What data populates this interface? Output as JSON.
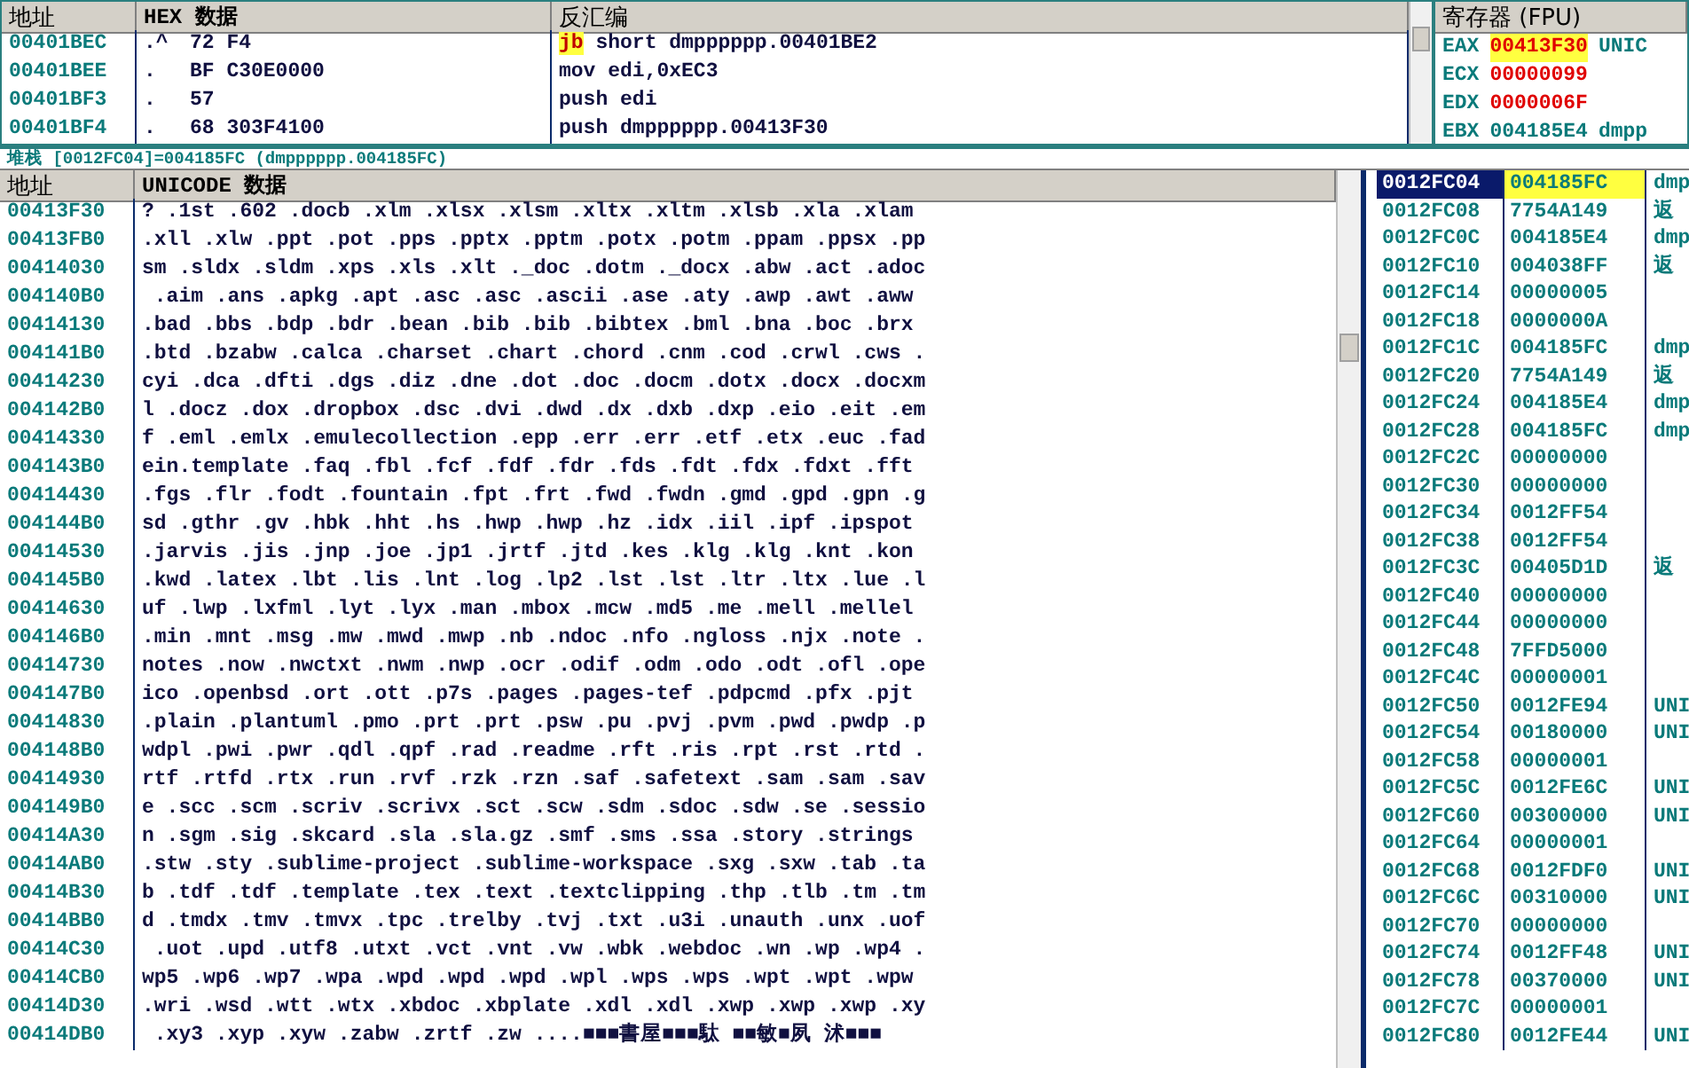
{
  "disassembly": {
    "columns": [
      "地址",
      "HEX 数据",
      "反汇编"
    ],
    "rows": [
      {
        "address": "00401BEC",
        "marker": ".^",
        "hex": "72 F4",
        "mnemonic": "jb",
        "operands": "short dmpppppp.00401BE2",
        "highlight": true
      },
      {
        "address": "00401BEE",
        "marker": ".",
        "hex": "BF C30E0000",
        "mnemonic": "mov",
        "operands": "edi,0xEC3",
        "highlight": false
      },
      {
        "address": "00401BF3",
        "marker": ".",
        "hex": "57",
        "mnemonic": "push",
        "operands": "edi",
        "highlight": false
      },
      {
        "address": "00401BF4",
        "marker": ".",
        "hex": "68 303F4100",
        "mnemonic": "push",
        "operands": "dmpppppp.00413F30",
        "highlight": false
      }
    ]
  },
  "registers": {
    "title": "寄存器 (FPU)",
    "rows": [
      {
        "name": "EAX",
        "value": "00413F30",
        "comment": "UNIC",
        "changed": true,
        "selected": true
      },
      {
        "name": "ECX",
        "value": "00000099",
        "changed": true,
        "selected": false
      },
      {
        "name": "EDX",
        "value": "0000006F",
        "changed": true,
        "selected": false
      },
      {
        "name": "EBX",
        "value": "004185E4",
        "comment": "dmpp",
        "changed": false,
        "selected": false
      }
    ]
  },
  "info_line": "堆栈 [0012FC04]=004185FC (dmpppppp.004185FC)",
  "dump": {
    "columns": [
      "地址",
      "UNICODE 数据"
    ],
    "rows": [
      {
        "address": "00413F30",
        "text": "? .1st .602 .docb .xlm .xlsx .xlsm .xltx .xltm .xlsb .xla .xlam"
      },
      {
        "address": "00413FB0",
        "text": ".xll .xlw .ppt .pot .pps .pptx .pptm .potx .potm .ppam .ppsx .pp"
      },
      {
        "address": "00414030",
        "text": "sm .sldx .sldm .xps .xls .xlt ._doc .dotm ._docx .abw .act .adoc"
      },
      {
        "address": "004140B0",
        "text": " .aim .ans .apkg .apt .asc .asc .ascii .ase .aty .awp .awt .aww"
      },
      {
        "address": "00414130",
        "text": ".bad .bbs .bdp .bdr .bean .bib .bib .bibtex .bml .bna .boc .brx"
      },
      {
        "address": "004141B0",
        "text": ".btd .bzabw .calca .charset .chart .chord .cnm .cod .crwl .cws ."
      },
      {
        "address": "00414230",
        "text": "cyi .dca .dfti .dgs .diz .dne .dot .doc .docm .dotx .docx .docxm"
      },
      {
        "address": "004142B0",
        "text": "l .docz .dox .dropbox .dsc .dvi .dwd .dx .dxb .dxp .eio .eit .em"
      },
      {
        "address": "00414330",
        "text": "f .eml .emlx .emulecollection .epp .err .err .etf .etx .euc .fad"
      },
      {
        "address": "004143B0",
        "text": "ein.template .faq .fbl .fcf .fdf .fdr .fds .fdt .fdx .fdxt .fft"
      },
      {
        "address": "00414430",
        "text": ".fgs .flr .fodt .fountain .fpt .frt .fwd .fwdn .gmd .gpd .gpn .g"
      },
      {
        "address": "004144B0",
        "text": "sd .gthr .gv .hbk .hht .hs .hwp .hwp .hz .idx .iil .ipf .ipspot"
      },
      {
        "address": "00414530",
        "text": ".jarvis .jis .jnp .joe .jp1 .jrtf .jtd .kes .klg .klg .knt .kon"
      },
      {
        "address": "004145B0",
        "text": ".kwd .latex .lbt .lis .lnt .log .lp2 .lst .lst .ltr .ltx .lue .l"
      },
      {
        "address": "00414630",
        "text": "uf .lwp .lxfml .lyt .lyx .man .mbox .mcw .md5 .me .mell .mellel"
      },
      {
        "address": "004146B0",
        "text": ".min .mnt .msg .mw .mwd .mwp .nb .ndoc .nfo .ngloss .njx .note ."
      },
      {
        "address": "00414730",
        "text": "notes .now .nwctxt .nwm .nwp .ocr .odif .odm .odo .odt .ofl .ope"
      },
      {
        "address": "004147B0",
        "text": "ico .openbsd .ort .ott .p7s .pages .pages-tef .pdpcmd .pfx .pjt"
      },
      {
        "address": "00414830",
        "text": ".plain .plantuml .pmo .prt .prt .psw .pu .pvj .pvm .pwd .pwdp .p"
      },
      {
        "address": "004148B0",
        "text": "wdpl .pwi .pwr .qdl .qpf .rad .readme .rft .ris .rpt .rst .rtd ."
      },
      {
        "address": "00414930",
        "text": "rtf .rtfd .rtx .run .rvf .rzk .rzn .saf .safetext .sam .sam .sav"
      },
      {
        "address": "004149B0",
        "text": "e .scc .scm .scriv .scrivx .sct .scw .sdm .sdoc .sdw .se .sessio"
      },
      {
        "address": "00414A30",
        "text": "n .sgm .sig .skcard .sla .sla.gz .smf .sms .ssa .story .strings"
      },
      {
        "address": "00414AB0",
        "text": ".stw .sty .sublime-project .sublime-workspace .sxg .sxw .tab .ta"
      },
      {
        "address": "00414B30",
        "text": "b .tdf .tdf .template .tex .text .textclipping .thp .tlb .tm .tm"
      },
      {
        "address": "00414BB0",
        "text": "d .tmdx .tmv .tmvx .tpc .trelby .tvj .txt .u3i .unauth .unx .uof"
      },
      {
        "address": "00414C30",
        "text": " .uot .upd .utf8 .utxt .vct .vnt .vw .wbk .webdoc .wn .wp .wp4 ."
      },
      {
        "address": "00414CB0",
        "text": "wp5 .wp6 .wp7 .wpa .wpd .wpd .wpd .wpl .wps .wps .wpt .wpt .wpw"
      },
      {
        "address": "00414D30",
        "text": ".wri .wsd .wtt .wtx .xbdoc .xbplate .xdl .xdl .xwp .xwp .xwp .xy"
      },
      {
        "address": "00414DB0",
        "text": " .xy3 .xyp .xyw .zabw .zrtf .zw ....■■■書屋■■■駄 ■■敏■夙 沭■■■"
      }
    ]
  },
  "stack": {
    "rows": [
      {
        "address": "0012FC04",
        "value": "004185FC",
        "comment": "dmp",
        "selected": true
      },
      {
        "address": "0012FC08",
        "value": "7754A149",
        "comment": "返",
        "selected": false
      },
      {
        "address": "0012FC0C",
        "value": "004185E4",
        "comment": "dmp",
        "selected": false
      },
      {
        "address": "0012FC10",
        "value": "004038FF",
        "comment": "返",
        "selected": false
      },
      {
        "address": "0012FC14",
        "value": "00000005",
        "selected": false
      },
      {
        "address": "0012FC18",
        "value": "0000000A",
        "selected": false
      },
      {
        "address": "0012FC1C",
        "value": "004185FC",
        "comment": "dmp",
        "selected": false
      },
      {
        "address": "0012FC20",
        "value": "7754A149",
        "comment": "返",
        "selected": false
      },
      {
        "address": "0012FC24",
        "value": "004185E4",
        "comment": "dmp",
        "selected": false
      },
      {
        "address": "0012FC28",
        "value": "004185FC",
        "comment": "dmp",
        "selected": false
      },
      {
        "address": "0012FC2C",
        "value": "00000000",
        "selected": false
      },
      {
        "address": "0012FC30",
        "value": "00000000",
        "selected": false
      },
      {
        "address": "0012FC34",
        "value": "0012FF54",
        "selected": false
      },
      {
        "address": "0012FC38",
        "value": "0012FF54",
        "selected": false
      },
      {
        "address": "0012FC3C",
        "value": "00405D1D",
        "comment": "返",
        "selected": false
      },
      {
        "address": "0012FC40",
        "value": "00000000",
        "selected": false
      },
      {
        "address": "0012FC44",
        "value": "00000000",
        "selected": false
      },
      {
        "address": "0012FC48",
        "value": "7FFD5000",
        "selected": false
      },
      {
        "address": "0012FC4C",
        "value": "00000001",
        "selected": false
      },
      {
        "address": "0012FC50",
        "value": "0012FE94",
        "comment": "UNI",
        "selected": false
      },
      {
        "address": "0012FC54",
        "value": "00180000",
        "comment": "UNI",
        "selected": false
      },
      {
        "address": "0012FC58",
        "value": "00000001",
        "selected": false
      },
      {
        "address": "0012FC5C",
        "value": "0012FE6C",
        "comment": "UNI",
        "selected": false
      },
      {
        "address": "0012FC60",
        "value": "00300000",
        "comment": "UNI",
        "selected": false
      },
      {
        "address": "0012FC64",
        "value": "00000001",
        "selected": false
      },
      {
        "address": "0012FC68",
        "value": "0012FDF0",
        "comment": "UNI",
        "selected": false
      },
      {
        "address": "0012FC6C",
        "value": "00310000",
        "comment": "UNI",
        "selected": false
      },
      {
        "address": "0012FC70",
        "value": "00000000",
        "selected": false
      },
      {
        "address": "0012FC74",
        "value": "0012FF48",
        "comment": "UNI",
        "selected": false
      },
      {
        "address": "0012FC78",
        "value": "00370000",
        "comment": "UNI",
        "selected": false
      },
      {
        "address": "0012FC7C",
        "value": "00000001",
        "selected": false
      },
      {
        "address": "0012FC80",
        "value": "0012FE44",
        "comment": "UNI",
        "selected": false
      }
    ]
  }
}
